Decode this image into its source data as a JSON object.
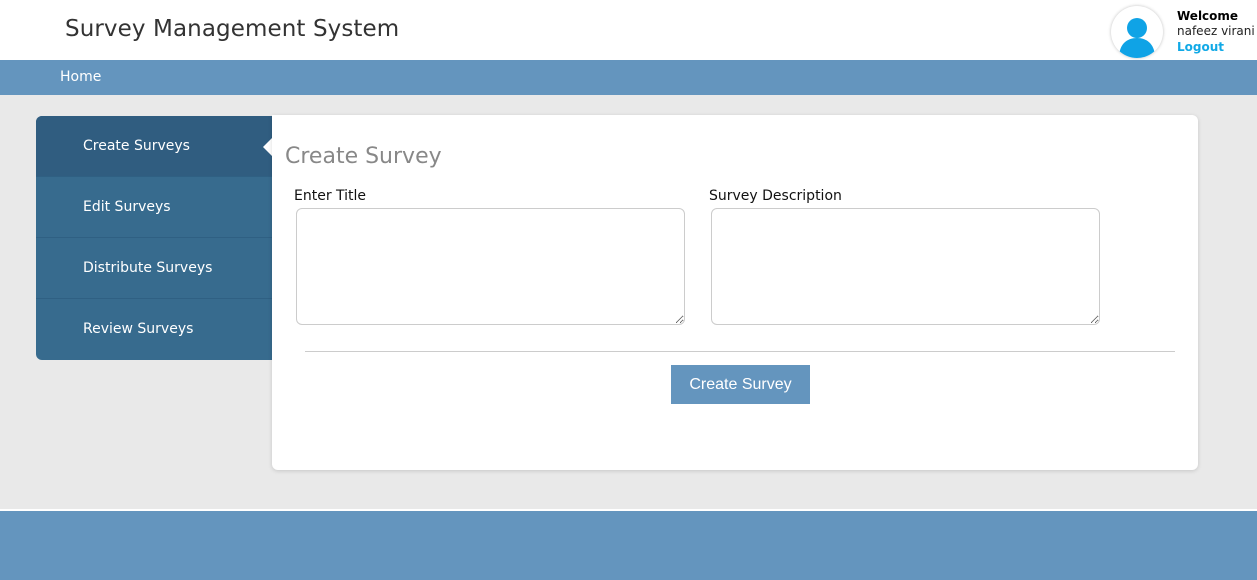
{
  "header": {
    "app_title": "Survey Management System",
    "welcome": "Welcome",
    "username": "nafeez virani",
    "logout": "Logout",
    "avatar_icon": "user-icon"
  },
  "nav": {
    "home": "Home"
  },
  "sidebar": {
    "items": [
      {
        "label": "Create Surveys",
        "active": true
      },
      {
        "label": "Edit Surveys",
        "active": false
      },
      {
        "label": "Distribute Surveys",
        "active": false
      },
      {
        "label": "Review Surveys",
        "active": false
      }
    ]
  },
  "form": {
    "title": "Create Survey",
    "title_label": "Enter Title",
    "title_value": "",
    "description_label": "Survey Description",
    "description_value": "",
    "submit_label": "Create Survey"
  },
  "colors": {
    "brand": "#6495be",
    "sidebar": "#376b8e",
    "link": "#11a9e6",
    "avatar": "#0fa3e6"
  }
}
